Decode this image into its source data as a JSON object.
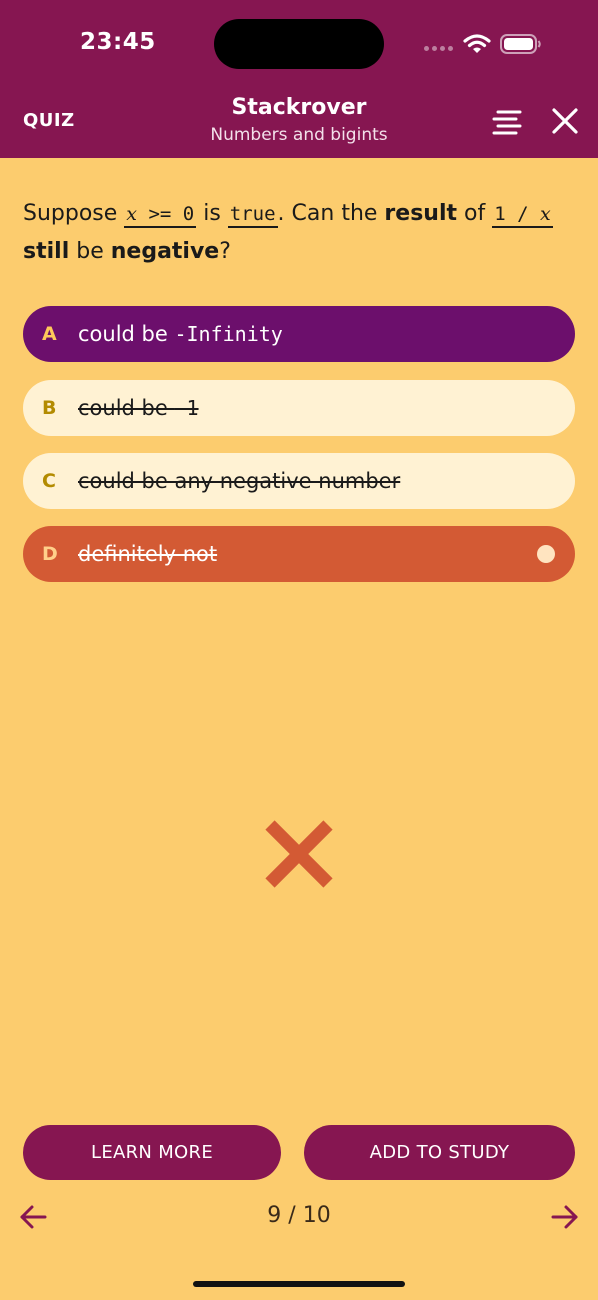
{
  "status_bar": {
    "time": "23:45"
  },
  "header": {
    "quiz_label": "QUIZ",
    "title": "Stackrover",
    "subtitle": "Numbers and bigints",
    "menu_icon": "menu-lines-icon",
    "close_icon": "close-icon"
  },
  "question": {
    "p1": "Suppose ",
    "code1_var": "x",
    "code1_rest": " >= 0",
    "p2": " is ",
    "code2": "true",
    "p3": ". Can the ",
    "b1": "result",
    "p4": " of ",
    "code3_start": "1 / ",
    "code3_var": "x",
    "b2": "still",
    "p5": " be ",
    "b3": "negative",
    "p6": "?"
  },
  "options": [
    {
      "letter": "A",
      "text_prefix": "could be ",
      "code": "-Infinity",
      "state": "correct"
    },
    {
      "letter": "B",
      "text_prefix": "could be ",
      "code": "-1",
      "state": "eliminated"
    },
    {
      "letter": "C",
      "text": "could be any negative number",
      "state": "eliminated"
    },
    {
      "letter": "D",
      "text": "definitely not",
      "state": "selected-wrong"
    }
  ],
  "result": {
    "icon": "wrong-x-icon"
  },
  "buttons": {
    "learn_more": "LEARN MORE",
    "add_to_study": "ADD TO STUDY"
  },
  "pager": {
    "label": "9 / 10"
  },
  "colors": {
    "header": "#861651",
    "background": "#fccc6e",
    "correct": "#6c0f6c",
    "wrong": "#d35a34",
    "option_default": "#fff2d3"
  }
}
